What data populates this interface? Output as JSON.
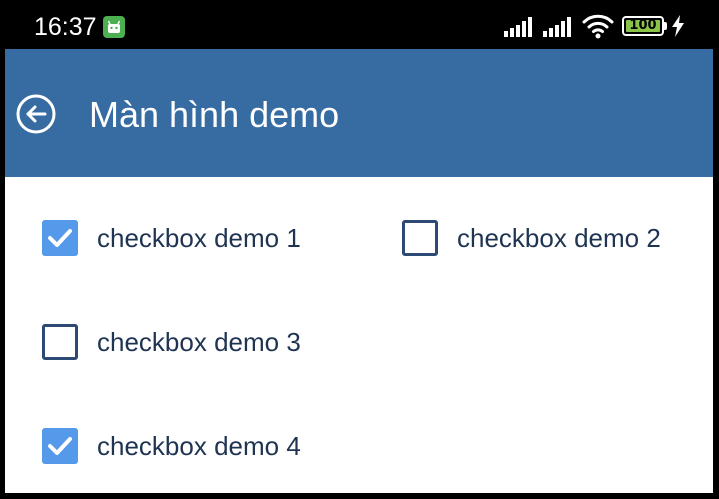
{
  "status_bar": {
    "time": "16:37",
    "battery_level": "100",
    "icons": [
      "android-notification-icon",
      "signal-icon",
      "signal-icon",
      "wifi-icon",
      "battery-icon",
      "charging-icon"
    ]
  },
  "app_bar": {
    "title": "Màn hình demo",
    "back_icon": "back-arrow-circle-icon",
    "background_color": "#376ca2"
  },
  "checkboxes": [
    {
      "label": "checkbox demo 1",
      "checked": true
    },
    {
      "label": "checkbox demo 2",
      "checked": false
    },
    {
      "label": "checkbox demo 3",
      "checked": false
    },
    {
      "label": "checkbox demo 4",
      "checked": true
    }
  ],
  "colors": {
    "checked": "#5599ea",
    "unchecked_border": "#2c4a73",
    "label_text": "#1f3452"
  }
}
